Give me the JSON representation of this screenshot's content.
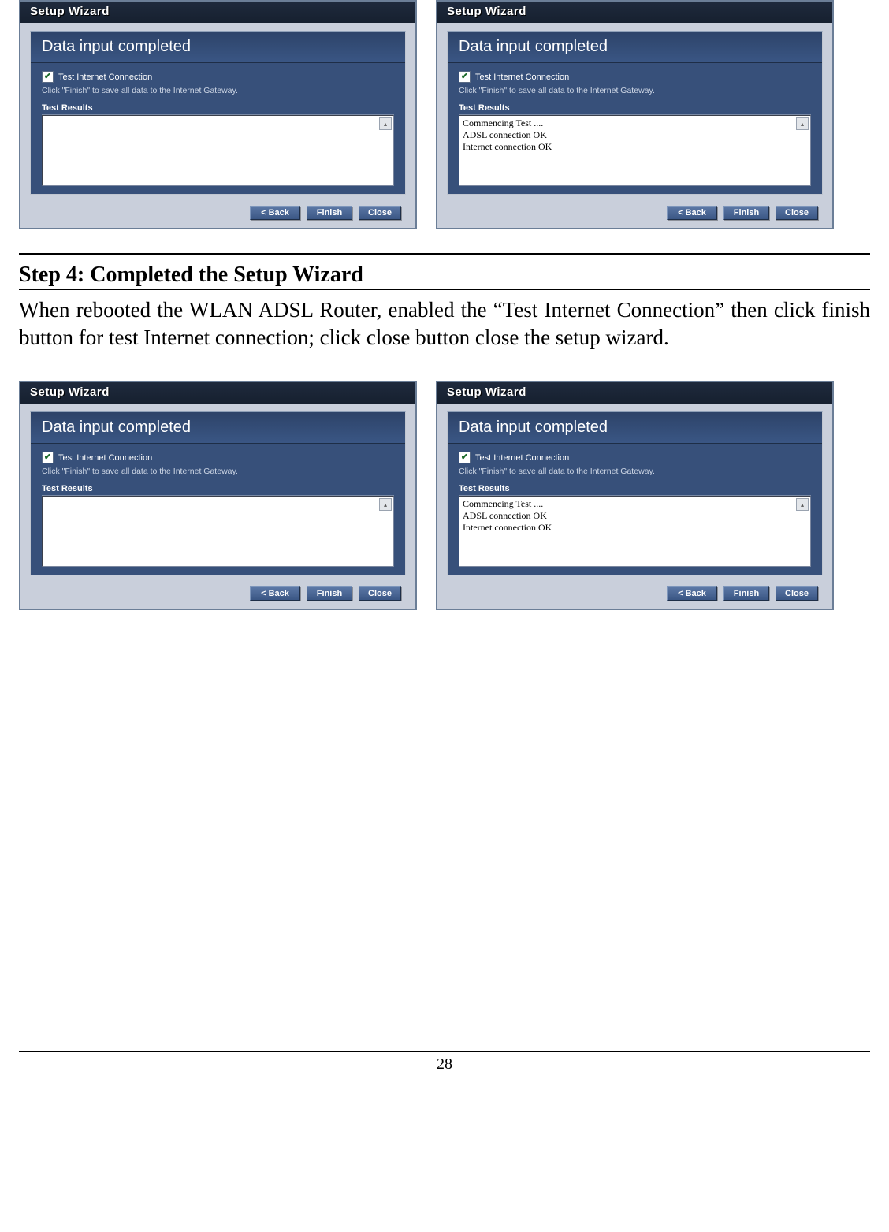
{
  "wizard_title": "Setup Wizard",
  "header_text": "Data input completed",
  "checkbox_label": "Test Internet Connection",
  "checkbox_checked_glyph": "✔",
  "instruction_text": "Click \"Finish\" to save all data to the Internet Gateway.",
  "test_results_label": "Test Results",
  "test_results_empty": "",
  "test_results_full": "Commencing Test ....\nADSL connection OK\nInternet connection OK",
  "buttons": {
    "back": "< Back",
    "finish": "Finish",
    "close": "Close"
  },
  "scroll_glyph": "▴",
  "step_title": "Step 4: Completed the Setup Wizard",
  "body_text": "When rebooted the WLAN ADSL Router, enabled the “Test Internet Connection” then click finish button for test Internet connection; click close button close the setup wizard.",
  "page_number": "28"
}
